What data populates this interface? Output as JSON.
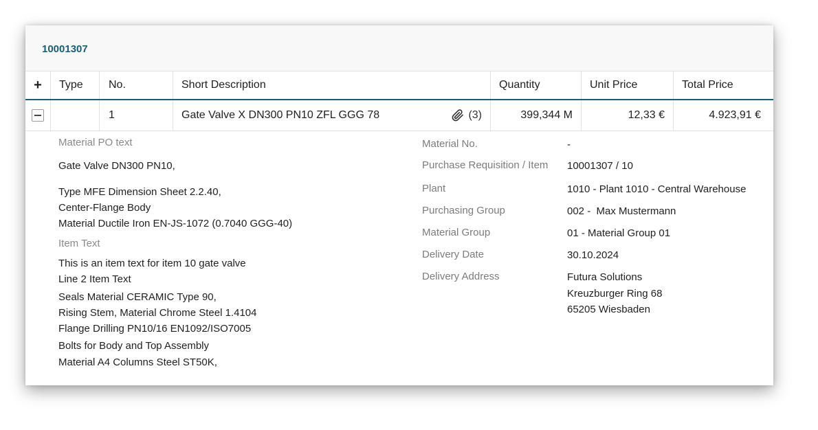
{
  "po": {
    "number": "10001307"
  },
  "table": {
    "add_icon": "plus-icon",
    "headers": {
      "type": "Type",
      "no": "No.",
      "short_description": "Short Description",
      "quantity": "Quantity",
      "unit_price": "Unit Price",
      "total_price": "Total Price"
    },
    "rows": [
      {
        "type": "",
        "no": "1",
        "short_description": "Gate Valve X DN300 PN10 ZFL GGG 78",
        "attachment_icon": "paperclip-icon",
        "attachment_count": "(3)",
        "quantity": "399,344 M",
        "unit_price": "12,33 €",
        "total_price": "4.923,91 €"
      }
    ]
  },
  "details": {
    "material_po_text": {
      "label": "Material PO text",
      "lines": [
        "Gate Valve DN300 PN10,",
        "Type MFE Dimension Sheet 2.2.40,",
        "Center-Flange Body",
        "Material Ductile Iron EN-JS-1072 (0.7040 GGG-40)"
      ]
    },
    "item_text": {
      "label": "Item Text",
      "lines": [
        "This is an item text for item 10 gate valve",
        "Line 2 Item Text",
        "Seals Material CERAMIC Type 90,",
        "Rising Stem, Material Chrome Steel 1.4104",
        "Flange Drilling PN10/16 EN1092/ISO7005",
        "Bolts for Body and Top Assembly",
        "Material A4 Columns Steel ST50K,"
      ]
    },
    "fields": {
      "material_no": {
        "label": "Material No.",
        "value": "-"
      },
      "purchase_requisition": {
        "label": "Purchase Requisition / Item",
        "value": "10001307 / 10"
      },
      "plant": {
        "label": "Plant",
        "value": "1010 - Plant 1010 - Central Warehouse"
      },
      "purchasing_group": {
        "label": "Purchasing Group",
        "value": "002 -  Max Mustermann"
      },
      "material_group": {
        "label": "Material Group",
        "value": "01 - Material Group 01"
      },
      "delivery_date": {
        "label": "Delivery Date",
        "value": "30.10.2024"
      },
      "delivery_address": {
        "label": "Delivery Address",
        "lines": [
          "Futura Solutions",
          "Kreuzburger Ring 68",
          "65205 Wiesbaden"
        ]
      }
    }
  },
  "colors": {
    "accent": "#1a5d73",
    "label": "#7c7c7c",
    "text": "#1f1f1f"
  }
}
